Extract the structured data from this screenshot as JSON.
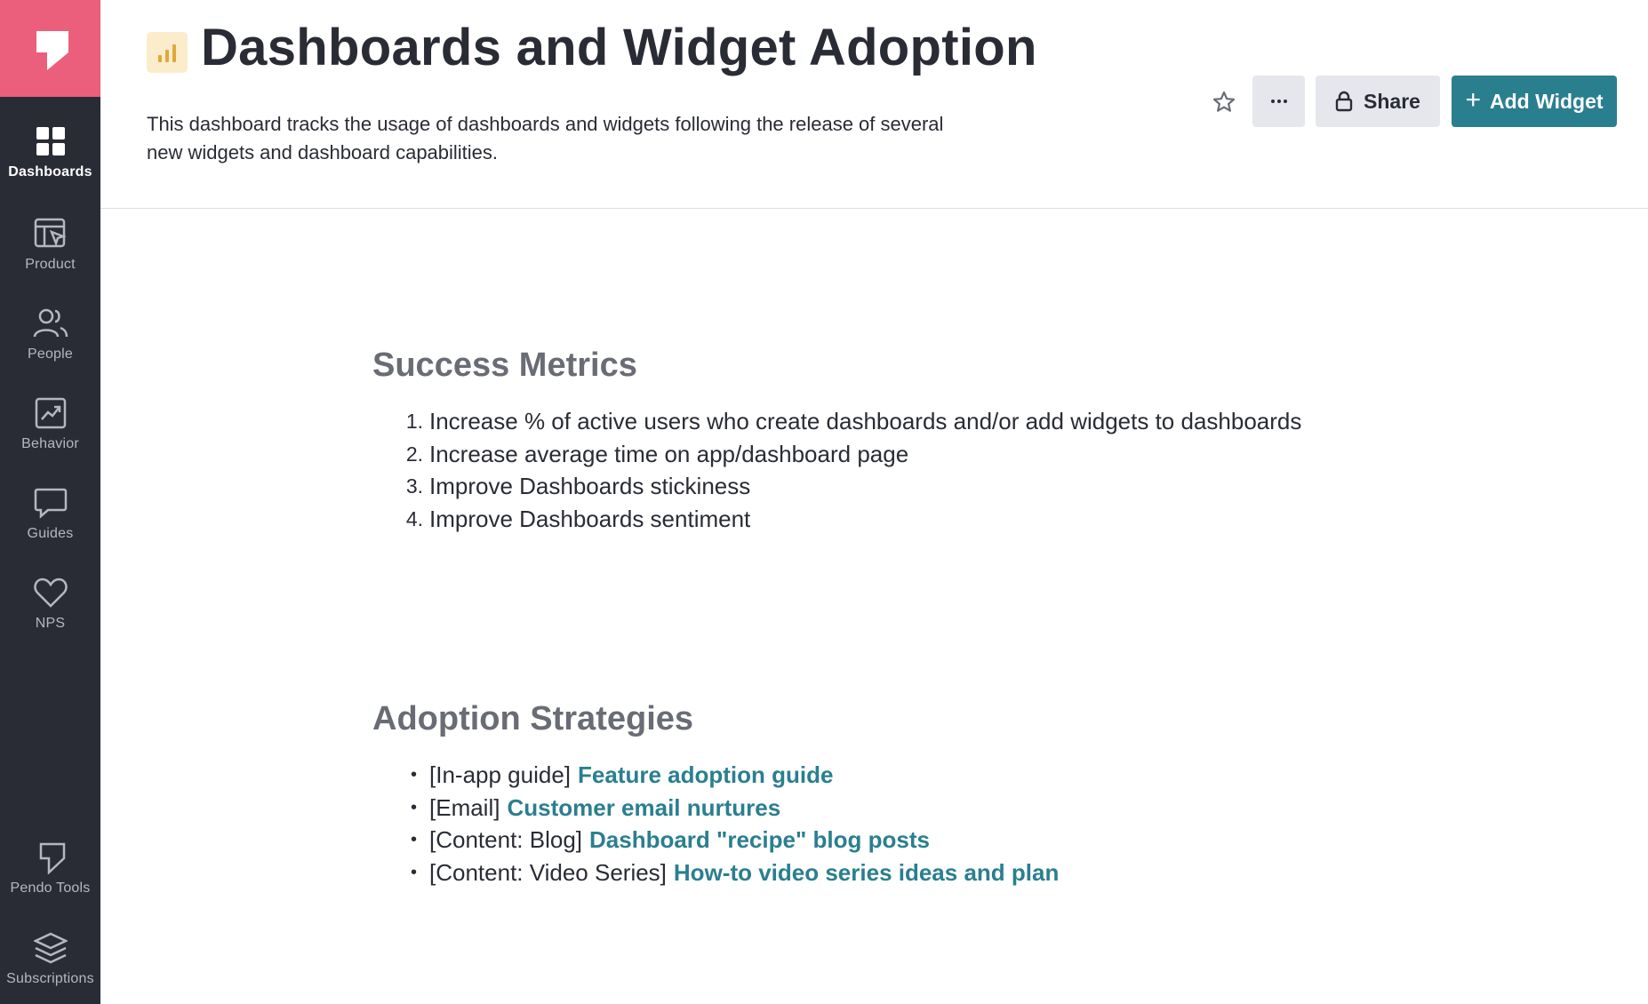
{
  "sidebar": {
    "items": [
      {
        "label": "Dashboards",
        "icon": "dashboards-icon",
        "active": true
      },
      {
        "label": "Product",
        "icon": "product-icon"
      },
      {
        "label": "People",
        "icon": "people-icon"
      },
      {
        "label": "Behavior",
        "icon": "behavior-icon"
      },
      {
        "label": "Guides",
        "icon": "guides-icon"
      },
      {
        "label": "NPS",
        "icon": "heart-icon"
      }
    ],
    "bottom_items": [
      {
        "label": "Pendo Tools",
        "icon": "pendo-tools-icon"
      },
      {
        "label": "Subscriptions",
        "icon": "layers-icon"
      }
    ]
  },
  "header": {
    "title": "Dashboards and Widget Adoption",
    "description": "This dashboard tracks the usage of dashboards and widgets following the release of several new widgets and dashboard capabilities.",
    "share_label": "Share",
    "add_widget_label": "Add Widget"
  },
  "success_metrics": {
    "title": "Success Metrics",
    "items": [
      {
        "num": "1.",
        "text": "Increase % of active users who create dashboards and/or add widgets to dashboards"
      },
      {
        "num": "2.",
        "text": "Increase average time on app/dashboard page"
      },
      {
        "num": "3.",
        "text": "Improve Dashboards stickiness"
      },
      {
        "num": "4.",
        "text": "Improve Dashboards sentiment"
      }
    ]
  },
  "adoption_strategies": {
    "title": "Adoption Strategies",
    "items": [
      {
        "prefix": "[In-app guide]",
        "link": "Feature adoption guide"
      },
      {
        "prefix": "[Email]",
        "link": "Customer email nurtures"
      },
      {
        "prefix": "[Content: Blog]",
        "link": "Dashboard \"recipe\" blog posts"
      },
      {
        "prefix": "[Content: Video Series]",
        "link": "How-to video series ideas and plan"
      }
    ]
  },
  "colors": {
    "sidebar_bg": "#2a2c35",
    "brand_pink": "#ec5f7c",
    "accent_teal": "#2a7f8f"
  }
}
